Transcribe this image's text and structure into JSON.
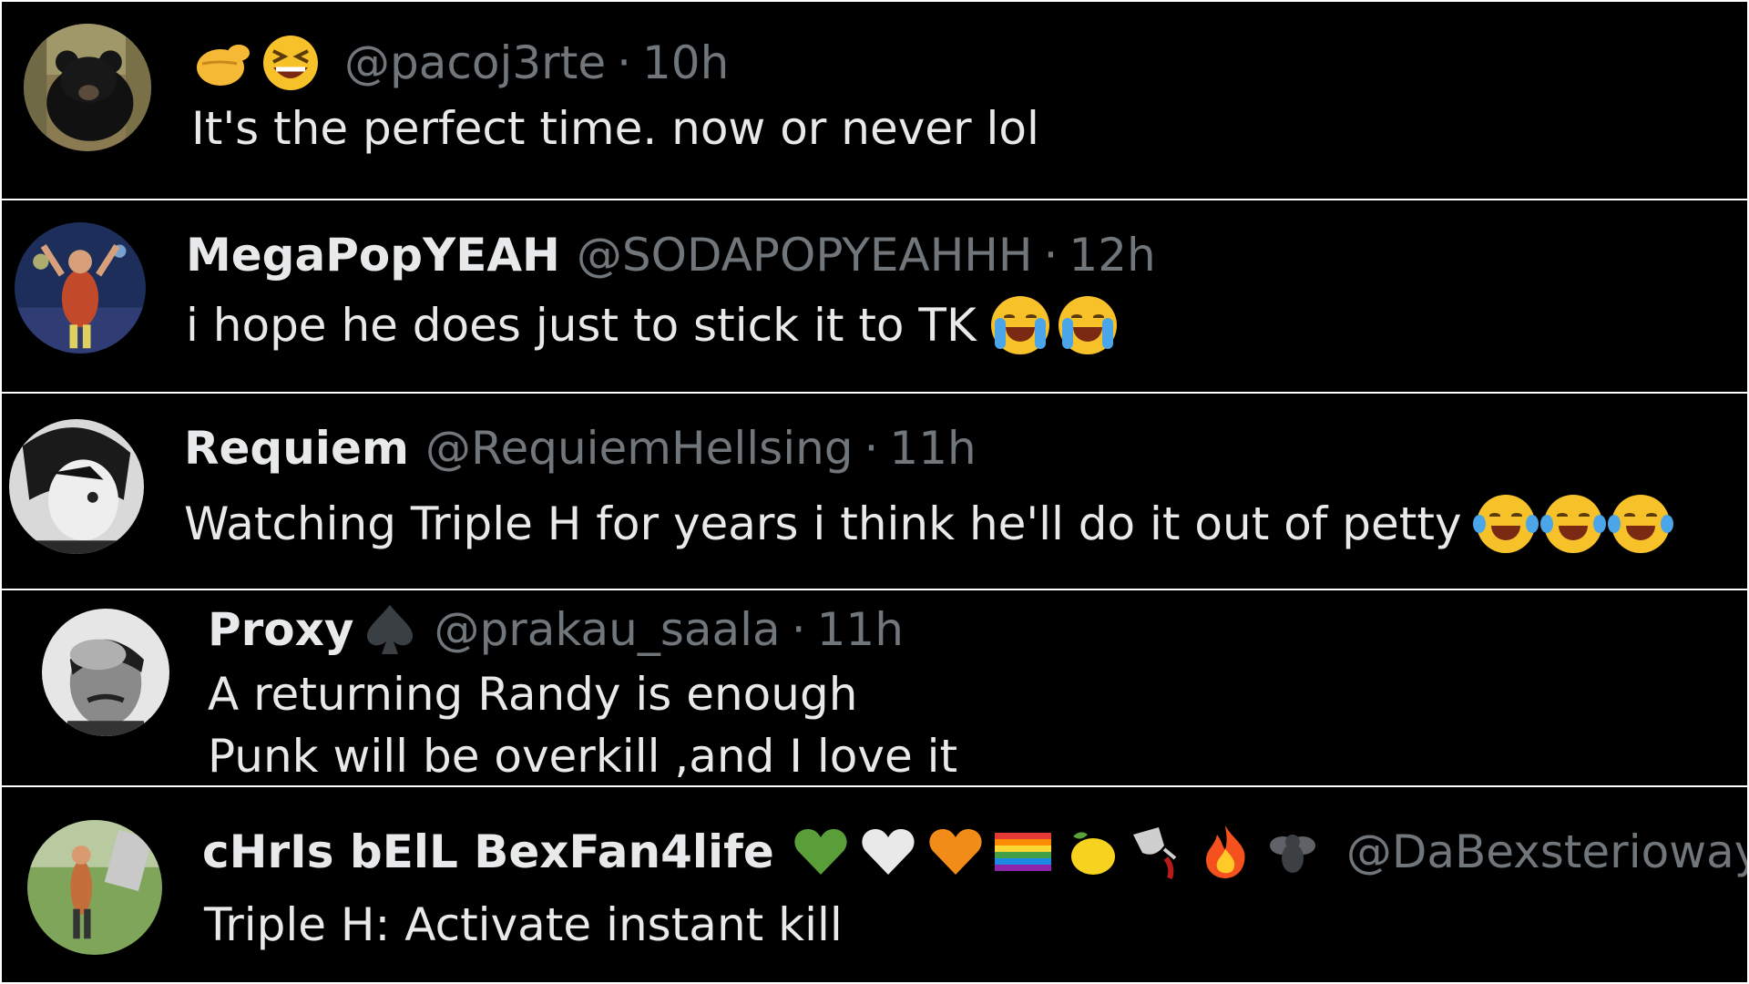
{
  "posts": [
    {
      "display_name": "",
      "name_emojis": [
        "pointing-finger-emoji",
        "grinning-squinting-face-emoji"
      ],
      "handle": "@pacoj3rte",
      "separator": "·",
      "time": "10h",
      "lines": [
        "It's the perfect time. now or never lol"
      ],
      "text_emojis": []
    },
    {
      "display_name": "MegaPopYEAH",
      "name_emojis": [],
      "handle": "@SODAPOPYEAHHH",
      "separator": "·",
      "time": "12h",
      "lines": [
        "i hope he does just to stick it to TK"
      ],
      "text_emojis": [
        "loudly-crying-face-emoji",
        "loudly-crying-face-emoji"
      ]
    },
    {
      "display_name": "Requiem",
      "name_emojis": [],
      "handle": "@RequiemHellsing",
      "separator": "·",
      "time": "11h",
      "lines": [
        "Watching Triple H for years i think he'll do it out of petty"
      ],
      "text_emojis": [
        "tears-of-joy-face-emoji",
        "tears-of-joy-face-emoji",
        "tears-of-joy-face-emoji"
      ]
    },
    {
      "display_name": "Proxy",
      "name_emojis": [
        "spade-suit-emoji"
      ],
      "handle": "@prakau_saala",
      "separator": "·",
      "time": "11h",
      "lines": [
        "A returning Randy is enough",
        "Punk will be overkill ,and I love it"
      ],
      "text_emojis": []
    },
    {
      "display_name": "cHrIs bElL BexFan4life",
      "name_emojis": [
        "green-heart-emoji",
        "white-heart-emoji",
        "orange-heart-emoji",
        "rainbow-flag-emoji",
        "lemon-emoji",
        "spilled-wine-glass-emoji",
        "fire-emoji",
        "fly-emoji"
      ],
      "handle": "@DaBexsterioway",
      "separator": "·",
      "time": "",
      "lines": [
        "Triple H: Activate instant kill"
      ],
      "text_emojis": []
    }
  ],
  "colors": {
    "background": "#000000",
    "divider": "#ffffff",
    "primary_text": "#e7e9ea",
    "secondary_text": "#71767b"
  }
}
